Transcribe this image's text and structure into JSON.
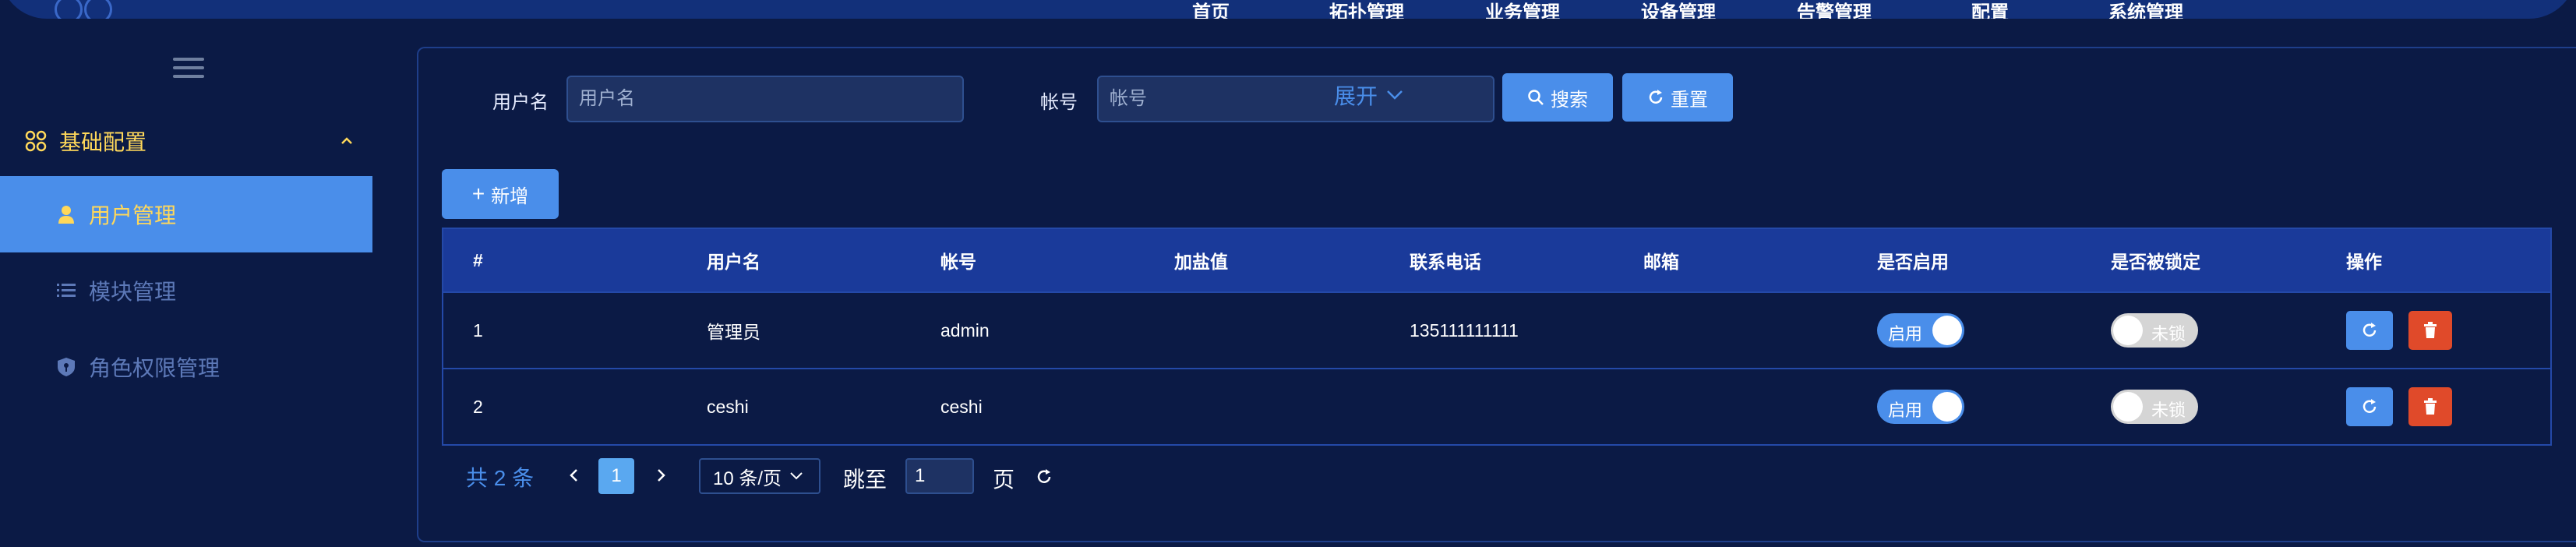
{
  "topnav": {
    "items": [
      "首页",
      "拓扑管理",
      "业务管理",
      "设备管理",
      "告警管理",
      "配置",
      "系统管理"
    ]
  },
  "sidebar": {
    "group": {
      "label": "基础配置",
      "icon": "grid-icon"
    },
    "items": [
      {
        "label": "用户管理",
        "icon": "user-icon",
        "active": true
      },
      {
        "label": "模块管理",
        "icon": "list-icon",
        "active": false
      },
      {
        "label": "角色权限管理",
        "icon": "shield-icon",
        "active": false
      }
    ]
  },
  "search": {
    "username_label": "用户名",
    "username_placeholder": "用户名",
    "account_label": "帐号",
    "account_placeholder": "帐号",
    "search_button": "搜索",
    "reset_button": "重置",
    "expand_label": "展开"
  },
  "toolbar": {
    "add_button": "新增"
  },
  "table": {
    "columns": [
      "#",
      "用户名",
      "帐号",
      "加盐值",
      "联系电话",
      "邮箱",
      "是否启用",
      "是否被锁定",
      "操作"
    ],
    "rows": [
      {
        "index": "1",
        "username": "管理员",
        "account": "admin",
        "salt": "",
        "phone": "135111111111",
        "email": "",
        "enabled_label": "启用",
        "locked_label": "未锁"
      },
      {
        "index": "2",
        "username": "ceshi",
        "account": "ceshi",
        "salt": "",
        "phone": "",
        "email": "",
        "enabled_label": "启用",
        "locked_label": "未锁"
      }
    ]
  },
  "pagination": {
    "total": "共 2 条",
    "current_page": "1",
    "page_size": "10 条/页",
    "jump_label": "跳至",
    "jump_value": "1",
    "page_suffix": "页"
  },
  "colors": {
    "background": "#0b1a45",
    "accent": "#4a8eea",
    "highlight": "#ffd85a",
    "table_header": "#1a3a9a",
    "delete": "#e04a2a"
  }
}
